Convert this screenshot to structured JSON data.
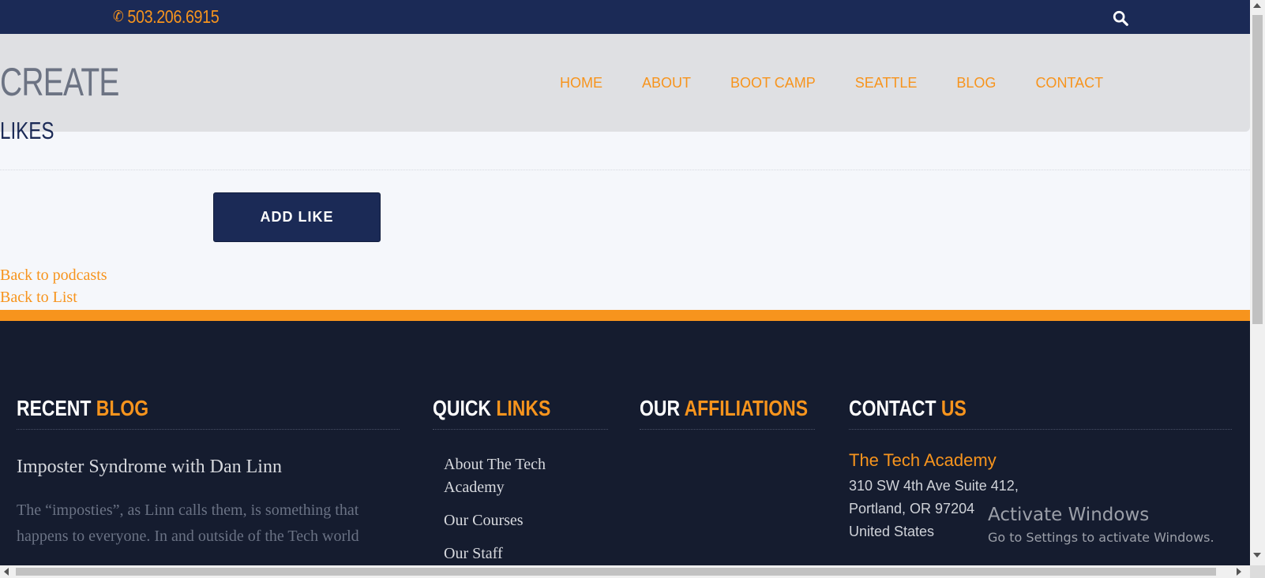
{
  "topbar": {
    "phone": "503.206.6915",
    "phone_icon": "phone-icon",
    "search_icon": "search-icon"
  },
  "brand": {
    "line1": "CREATE",
    "line2": "LIKES"
  },
  "nav": {
    "items": [
      "HOME",
      "ABOUT",
      "BOOT CAMP",
      "SEATTLE",
      "BLOG",
      "CONTACT"
    ]
  },
  "main": {
    "add_button": "ADD LIKE",
    "links": [
      "Back to podcasts",
      "Back to List"
    ]
  },
  "footer": {
    "blog": {
      "head_white": "RECENT",
      "head_accent": "BLOG",
      "post_title": "Imposter Syndrome with Dan Linn",
      "excerpt": "The “imposties”, as Linn calls them, is something that happens to everyone. In and outside of the Tech world"
    },
    "quick": {
      "head_white": "QUICK",
      "head_accent": "LINKS",
      "items": [
        "About The Tech Academy",
        "Our Courses",
        "Our Staff"
      ]
    },
    "affiliations": {
      "head_white": "OUR",
      "head_accent": "AFFILIATIONS"
    },
    "contact": {
      "head_white": "CONTACT",
      "head_accent": "US",
      "org": "The Tech Academy",
      "address": [
        "310 SW 4th Ave Suite 412,",
        "Portland, OR 97204",
        "United States"
      ]
    }
  },
  "watermark": {
    "line1": "Activate Windows",
    "line2": "Go to Settings to activate Windows."
  },
  "colors": {
    "navy": "#1b2a56",
    "orange": "#f7941d",
    "footer_bg": "#151c2f",
    "nav_band": "#dfe0e3"
  }
}
